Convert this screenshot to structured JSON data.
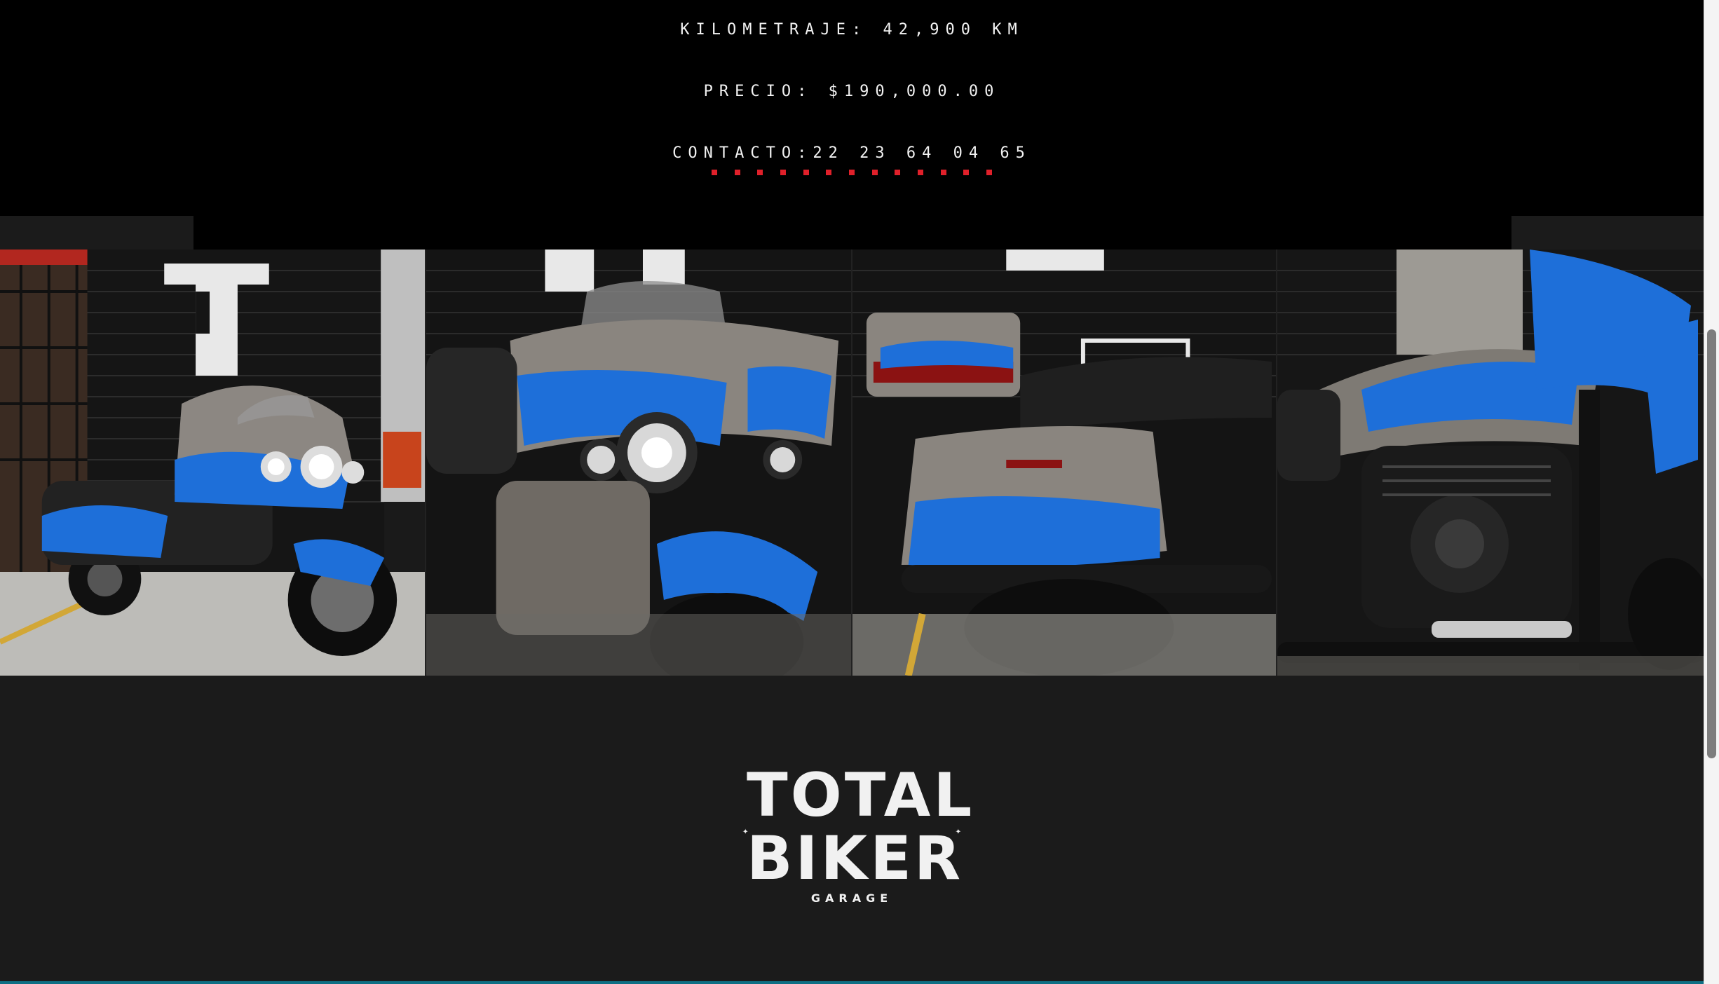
{
  "listing": {
    "kilometraje": "KILOMETRAJE: 42,900 KM",
    "precio": "PRECIO: $190,000.00",
    "contacto": "CONTACTO:22 23 64 04 65"
  },
  "gallery": {
    "photos": [
      {
        "name": "motorcycle-front-three-quarter"
      },
      {
        "name": "motorcycle-fairing-headlight"
      },
      {
        "name": "motorcycle-rear-saddlebag"
      },
      {
        "name": "motorcycle-engine-tank"
      }
    ]
  },
  "footer": {
    "logo": {
      "line1": "TOTAL",
      "line2": "BIKER",
      "line3": "GARAGE"
    }
  },
  "colors": {
    "background": "#000000",
    "footer_bg": "#1b1b1b",
    "accent_red": "#e0202a",
    "flame_blue": "#1e6fd9",
    "text": "#f2f2f2"
  }
}
